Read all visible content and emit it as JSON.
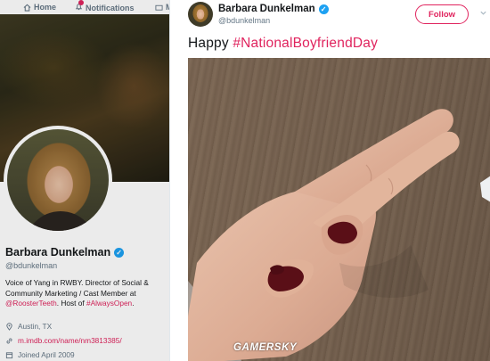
{
  "nav": {
    "home_label": "Home",
    "notifications_label": "Notifications",
    "more_label": "M"
  },
  "profile": {
    "name": "Barbara Dunkelman",
    "handle": "@bdunkelman",
    "bio_text": "Voice of Yang in RWBY. Director of Social & Community Marketing / Cast Member at ",
    "bio_link1": "@RoosterTeeth",
    "bio_mid": ". Host of ",
    "bio_link2": "#AlwaysOpen",
    "bio_end": ".",
    "location": "Austin, TX",
    "website": "m.imdb.com/name/nm3813385/",
    "joined": "Joined April 2009"
  },
  "tweet": {
    "name": "Barbara Dunkelman",
    "handle": "@bdunkelman",
    "follow_label": "Follow",
    "text_plain": "Happy ",
    "hashtag": "#NationalBoyfriendDay"
  },
  "watermark": "GAMERSKY",
  "colors": {
    "accent": "#e0245e",
    "verified": "#1da1f2",
    "text": "#14171a",
    "muted": "#657786",
    "nail_polish": "#5a0f17"
  },
  "icons": [
    "home-icon",
    "bell-icon",
    "verified-badge-icon",
    "location-icon",
    "link-icon",
    "calendar-icon",
    "chevron-down-icon"
  ]
}
